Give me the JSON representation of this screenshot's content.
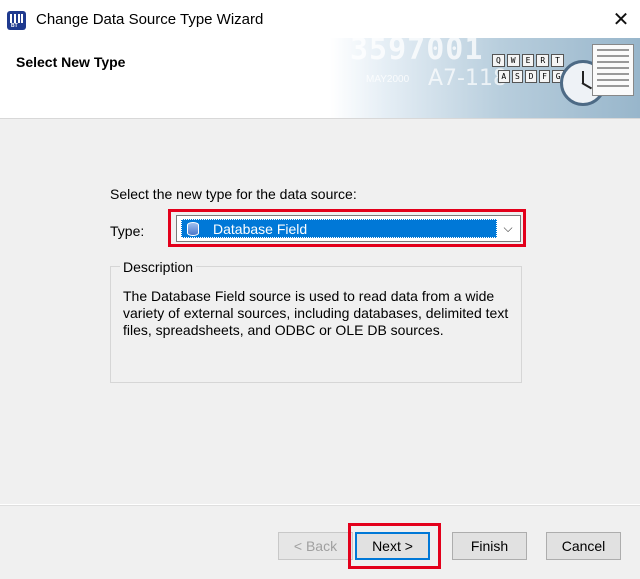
{
  "window": {
    "title": "Change Data Source Type Wizard",
    "close_glyph": "✕",
    "app_icon_text": "BT"
  },
  "header": {
    "title": "Select New Type",
    "banner": {
      "number_text": "3597001",
      "code_text": "A7-118",
      "date_text": "MAY2000",
      "keys_row1": [
        "Q",
        "W",
        "E",
        "R",
        "T"
      ],
      "keys_row2": [
        "A",
        "S",
        "D",
        "F",
        "G"
      ]
    }
  },
  "main": {
    "prompt": "Select the new type for the data source:",
    "type_label": "Type:",
    "type_value": "Database Field",
    "type_icon": "database-icon",
    "chevron_glyph": "⌵",
    "description_legend": "Description",
    "description_text": "The Database Field source is used to read data from a wide variety of external sources, including databases, delimited text files, spreadsheets, and ODBC or OLE DB sources."
  },
  "footer": {
    "back_label": "< Back",
    "next_label": "Next >",
    "finish_label": "Finish",
    "cancel_label": "Cancel"
  },
  "colors": {
    "highlight": "#e3001b",
    "selection": "#0078d7",
    "panel": "#f0f0f0"
  }
}
